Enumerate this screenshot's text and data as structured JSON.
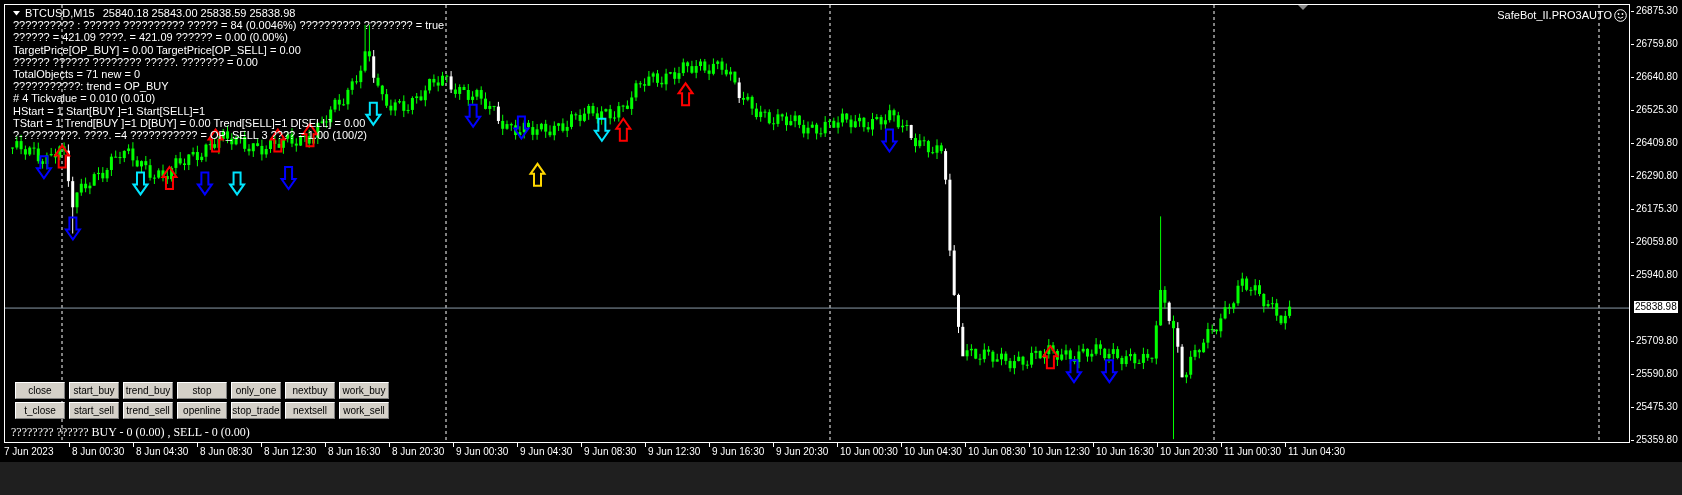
{
  "chart": {
    "header": {
      "symbol_timeframe": "BTCUSD,M15",
      "quotes": "25840.18 25843.00 25838.59 25838.98"
    },
    "info_lines": [
      "?????????? : ?????? ??????????  ????? = 84 (0.0046%) ?????????? ???????? = true",
      "?????? = 421.09 ????. = 421.09 ?????? = 0.00 (0.00%)",
      "TargetPrice[OP_BUY] = 0.00 TargetPrice[OP_SELL] = 0.00",
      "?????? ?????? ???????? ?????. ??????? = 0.00",
      "TotalObjects = 71 new = 0",
      "???????????: trend = OP_BUY",
      "# 4 Tickvalue = 0.010 (0.010)",
      "HStart = 1 Start[BUY ]=1 Start[SELL]=1",
      "TStart = 1 Trend[BUY ]=1 D[BUY] = 0.00 Trend[SELL]=1 D[SELL] = 0.00",
      "?-?????????. ????. =4 ??????????? = OP_SELL 3 ???? = 1.00 (100/2)"
    ],
    "expert": "SafeBot_II.PRO3AUTO",
    "buttons": [
      [
        {
          "label": "close"
        },
        {
          "label": "start_buy"
        },
        {
          "label": "trend_buy"
        },
        {
          "label": "stop"
        },
        {
          "label": "only_one"
        },
        {
          "label": "nextbuy"
        },
        {
          "label": "work_buy"
        }
      ],
      [
        {
          "label": "t_close"
        },
        {
          "label": "start_sell"
        },
        {
          "label": "trend_sell"
        },
        {
          "label": "openline"
        },
        {
          "label": "stop_trade"
        },
        {
          "label": "nextsell"
        },
        {
          "label": "work_sell"
        }
      ]
    ],
    "status_line": "???????? ?????? BUY - 0 (0.00) , SELL - 0 (0.00)",
    "signals": [
      {
        "kind": "down",
        "color": "#0000ff"
      },
      {
        "kind": "up",
        "color": "#ff0000"
      },
      {
        "kind": "down",
        "color": "#0000ff"
      },
      {
        "kind": "down",
        "color": "#00e5ff"
      },
      {
        "kind": "up",
        "color": "#ff0000"
      },
      {
        "kind": "down",
        "color": "#0000ff"
      },
      {
        "kind": "up",
        "color": "#ff0000"
      },
      {
        "kind": "down",
        "color": "#00e5ff"
      },
      {
        "kind": "up",
        "color": "#ff0000"
      },
      {
        "kind": "down",
        "color": "#0000ff"
      },
      {
        "kind": "up",
        "color": "#ff0000"
      },
      {
        "kind": "down",
        "color": "#00e5ff"
      },
      {
        "kind": "down",
        "color": "#0000ff"
      },
      {
        "kind": "down",
        "color": "#0000ff"
      },
      {
        "kind": "up",
        "color": "#ffd700"
      },
      {
        "kind": "down",
        "color": "#00e5ff"
      },
      {
        "kind": "up",
        "color": "#ff0000"
      },
      {
        "kind": "up",
        "color": "#ff0000"
      },
      {
        "kind": "down",
        "color": "#0000ff"
      },
      {
        "kind": "up",
        "color": "#ff0000"
      },
      {
        "kind": "down",
        "color": "#0000ff"
      },
      {
        "kind": "down",
        "color": "#0000ff"
      }
    ],
    "price_axis": {
      "labels": [
        "26875.30",
        "26759.80",
        "26640.80",
        "26525.30",
        "26409.80",
        "26290.80",
        "26175.30",
        "26059.80",
        "25940.80",
        "25709.80",
        "25590.80",
        "25475.30",
        "25359.80"
      ],
      "current": "25838.98"
    },
    "time_axis": {
      "labels": [
        "7 Jun 2023",
        "8 Jun 00:30",
        "8 Jun 04:30",
        "8 Jun 08:30",
        "8 Jun 12:30",
        "8 Jun 16:30",
        "8 Jun 20:30",
        "9 Jun 00:30",
        "9 Jun 04:30",
        "9 Jun 08:30",
        "9 Jun 12:30",
        "9 Jun 16:30",
        "9 Jun 20:30",
        "10 Jun 00:30",
        "10 Jun 04:30",
        "10 Jun 08:30",
        "10 Jun 12:30",
        "10 Jun 16:30",
        "10 Jun 20:30",
        "11 Jun 00:30",
        "11 Jun 04:30"
      ]
    }
  }
}
